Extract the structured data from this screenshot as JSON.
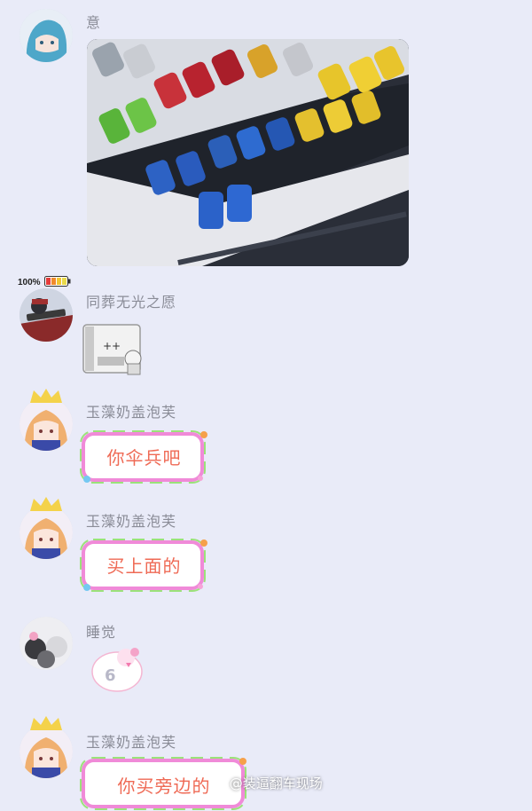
{
  "messages": [
    {
      "nickname": "意",
      "type": "image",
      "image_alt": "vending machine drinks"
    },
    {
      "nickname": "同葬无光之愿",
      "type": "sticker",
      "badge": "100%"
    },
    {
      "nickname": "玉藻奶盖泡芙",
      "type": "text",
      "text": "你伞兵吧"
    },
    {
      "nickname": "玉藻奶盖泡芙",
      "type": "text",
      "text": "买上面的"
    },
    {
      "nickname": "睡觉",
      "type": "sticker",
      "sticker_text": "6"
    },
    {
      "nickname": "玉藻奶盖泡芙",
      "type": "text",
      "text": "你买旁边的"
    }
  ],
  "watermark": "@装逼翻车现场",
  "colors": {
    "background": "#e9ebf8",
    "nickname": "#8a8c97",
    "bubble_text": "#ef6a55"
  }
}
